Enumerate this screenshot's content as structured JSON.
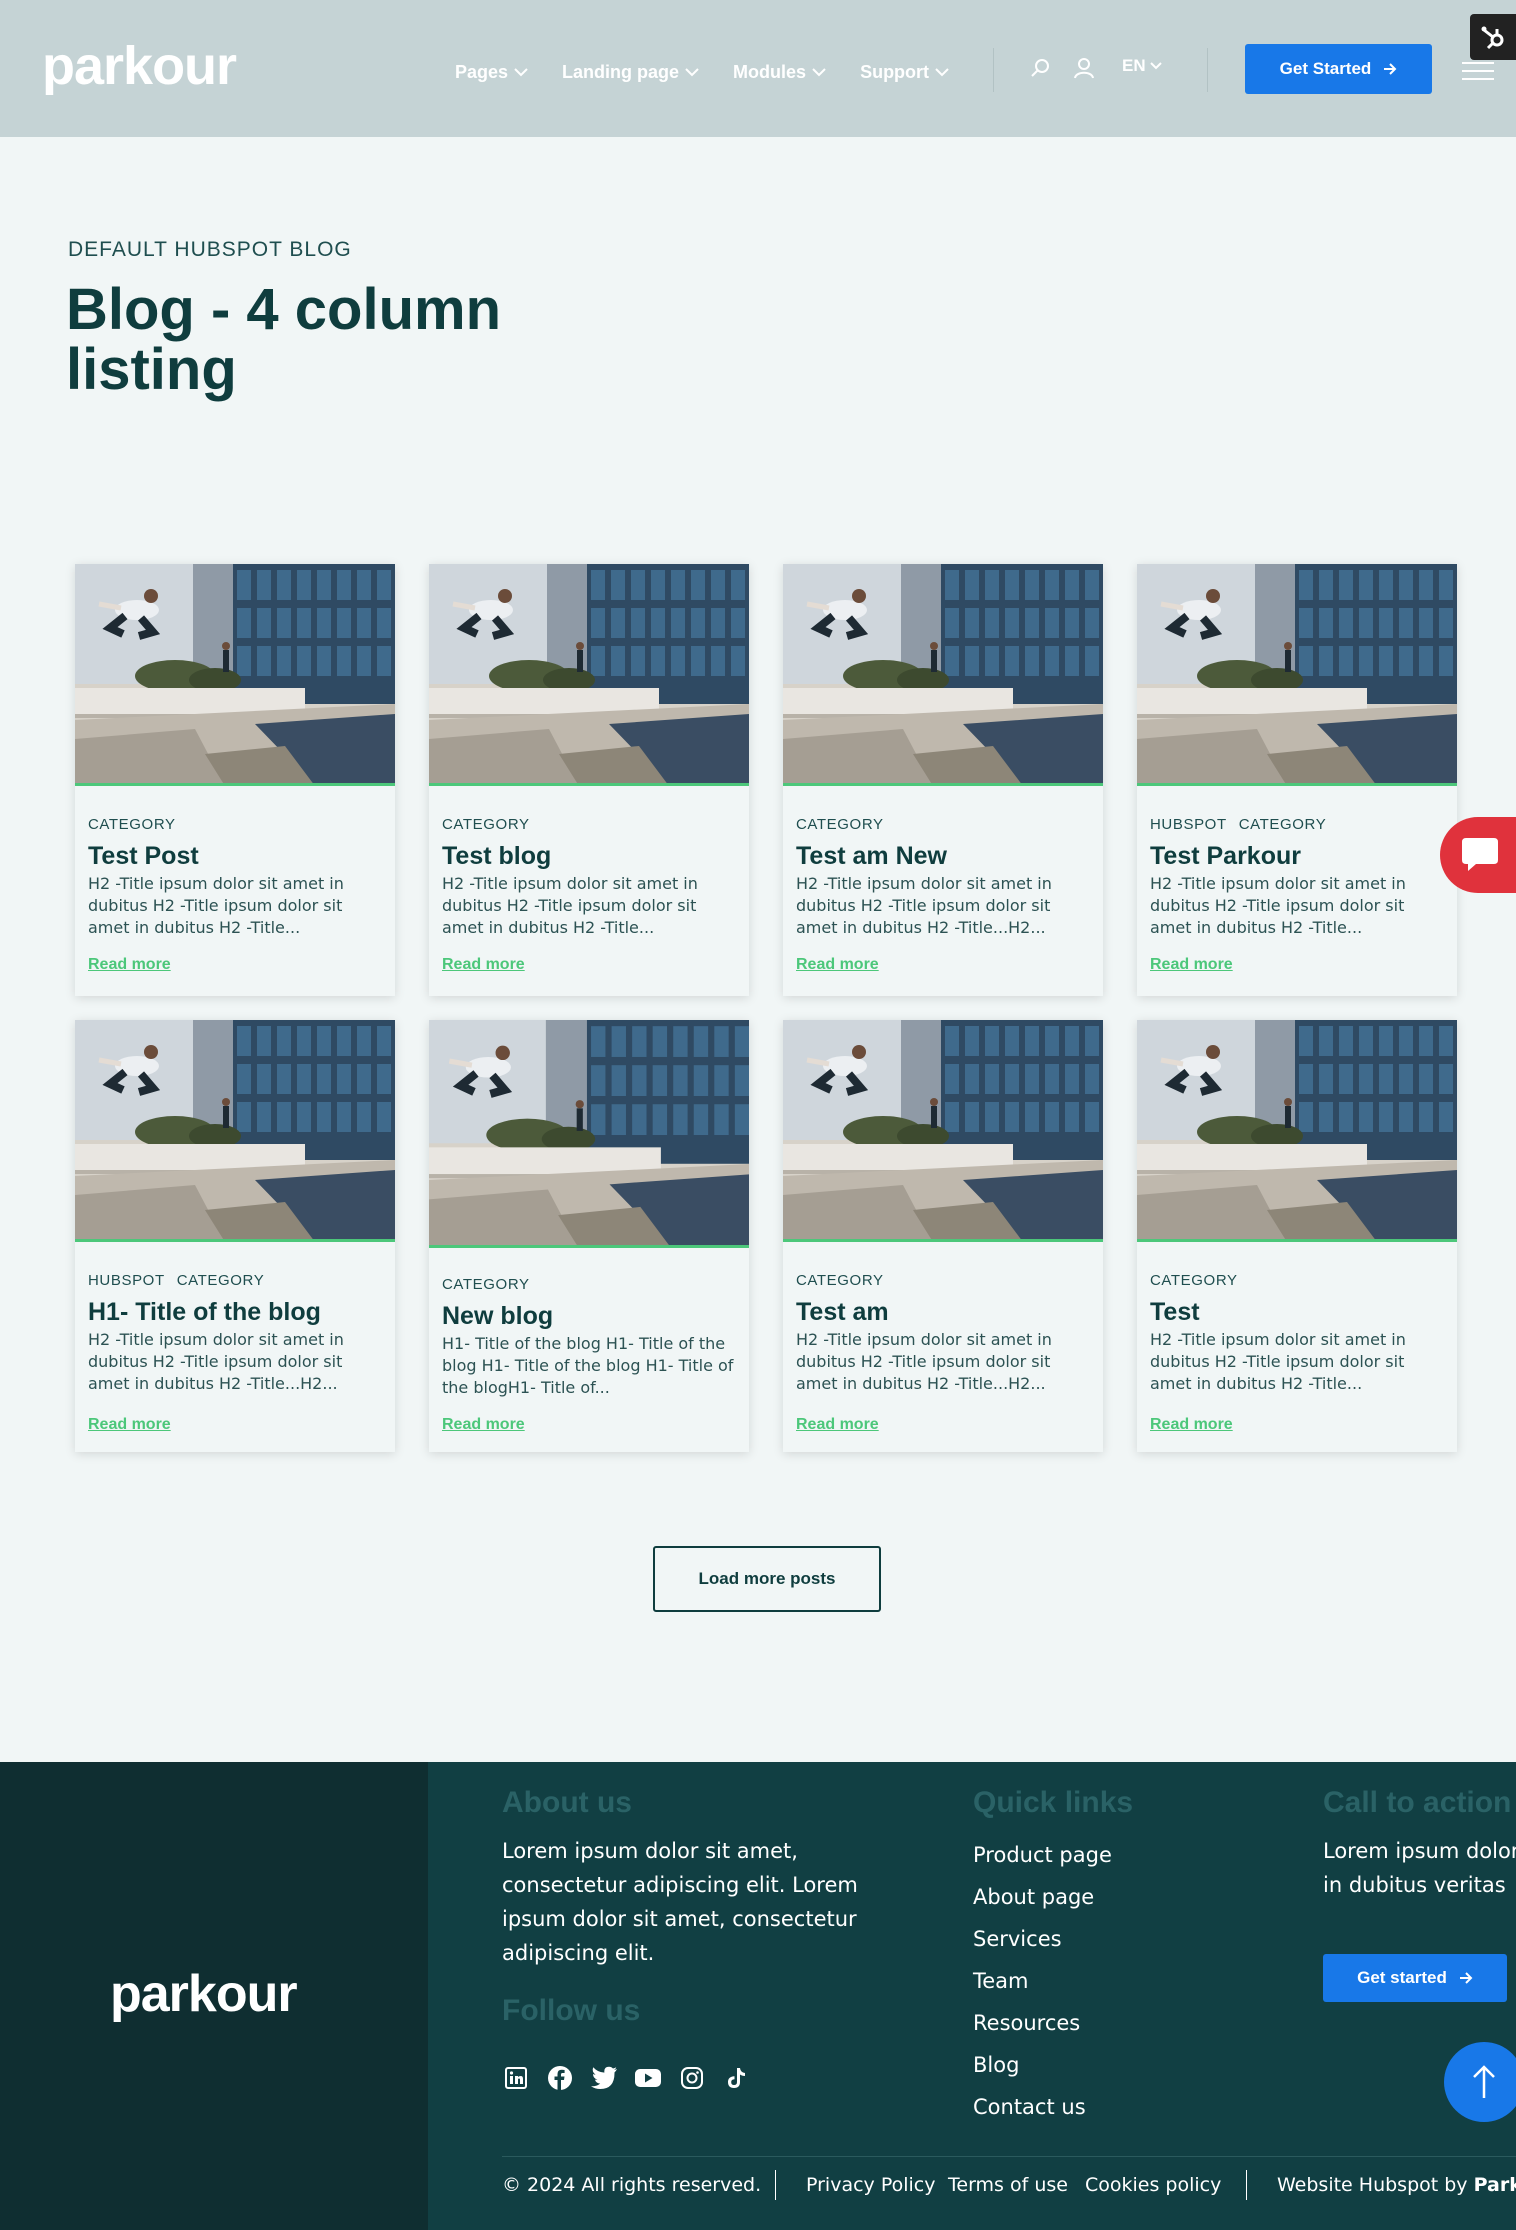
{
  "header": {
    "logo": "parkour",
    "nav": [
      {
        "label": "Pages"
      },
      {
        "label": "Landing page"
      },
      {
        "label": "Modules"
      },
      {
        "label": "Support"
      }
    ],
    "lang": "EN",
    "cta_label": "Get Started",
    "icons": [
      "search-icon",
      "user-icon",
      "chevron-down-icon",
      "arrow-right-icon",
      "menu-icon",
      "hubspot-sprocket-icon"
    ]
  },
  "hero": {
    "eyebrow": "DEFAULT HUBSPOT BLOG",
    "title": "Blog - 4 column listing"
  },
  "posts": [
    {
      "categories": [
        "CATEGORY"
      ],
      "title": "Test Post",
      "excerpt": "H2 -Title ipsum dolor sit amet in dubitus H2 -Title ipsum dolor sit amet in dubitus H2 -Title...",
      "read_more": "Read more"
    },
    {
      "categories": [
        "CATEGORY"
      ],
      "title": "Test blog",
      "excerpt": "H2 -Title ipsum dolor sit amet in dubitus H2 -Title ipsum dolor sit amet in dubitus H2 -Title...",
      "read_more": "Read more"
    },
    {
      "categories": [
        "CATEGORY"
      ],
      "title": "Test am New",
      "excerpt": "H2 -Title ipsum dolor sit amet in dubitus H2 -Title ipsum dolor sit amet in dubitus H2 -Title...H2...",
      "read_more": "Read more"
    },
    {
      "categories": [
        "HUBSPOT",
        "CATEGORY"
      ],
      "title": "Test Parkour",
      "excerpt": "H2 -Title ipsum dolor sit amet in dubitus H2 -Title ipsum dolor sit amet in dubitus H2 -Title...",
      "read_more": "Read more"
    },
    {
      "categories": [
        "HUBSPOT",
        "CATEGORY"
      ],
      "title": "H1- Title of the blog",
      "excerpt": "H2 -Title ipsum dolor sit amet in dubitus H2 -Title ipsum dolor sit amet in dubitus H2 -Title...H2...",
      "read_more": "Read more"
    },
    {
      "categories": [
        "CATEGORY"
      ],
      "title": "New blog",
      "excerpt": "H1- Title of the blog H1- Title of the blog H1- Title of the blog H1- Title of the blogH1- Title of...",
      "read_more": "Read more"
    },
    {
      "categories": [
        "CATEGORY"
      ],
      "title": "Test am",
      "excerpt": "H2 -Title ipsum dolor sit amet in dubitus H2 -Title ipsum dolor sit amet in dubitus H2 -Title...H2...",
      "read_more": "Read more"
    },
    {
      "categories": [
        "CATEGORY"
      ],
      "title": "Test",
      "excerpt": "H2 -Title ipsum dolor sit amet in dubitus H2 -Title ipsum dolor sit amet in dubitus H2 -Title...",
      "read_more": "Read more"
    }
  ],
  "load_more": "Load more posts",
  "footer": {
    "logo": "parkour",
    "about_heading": "About us",
    "about_text": "Lorem ipsum dolor sit amet, consectetur adipiscing elit. Lorem ipsum dolor sit amet, consectetur adipiscing elit.",
    "follow_heading": "Follow us",
    "social": [
      "linkedin-icon",
      "facebook-icon",
      "twitter-icon",
      "youtube-icon",
      "instagram-icon",
      "tiktok-icon"
    ],
    "quick_heading": "Quick links",
    "quick_links": [
      "Product page",
      "About page",
      "Services",
      "Team",
      "Resources",
      "Blog",
      "Contact us"
    ],
    "cta_heading": "Call to action",
    "cta_text": "Lorem ipsum dolor sit amet in dubitus veritas",
    "cta_button": "Get started",
    "copyright": "© 2024 All rights reserved.",
    "privacy": "Privacy Policy",
    "terms": "Terms of use",
    "cookies": "Cookies policy",
    "credit_prefix": "Website Hubspot by ",
    "credit_brand": "Parkour"
  },
  "colors": {
    "header_bg": "#c5d3d5",
    "page_bg": "#f1f6f6",
    "primary": "#1878e8",
    "accent_green": "#4cc77a",
    "heading": "#0f3d3e",
    "footer_bg": "#113f43",
    "footer_left_bg": "#0f2e31",
    "chat": "#e0323c"
  }
}
